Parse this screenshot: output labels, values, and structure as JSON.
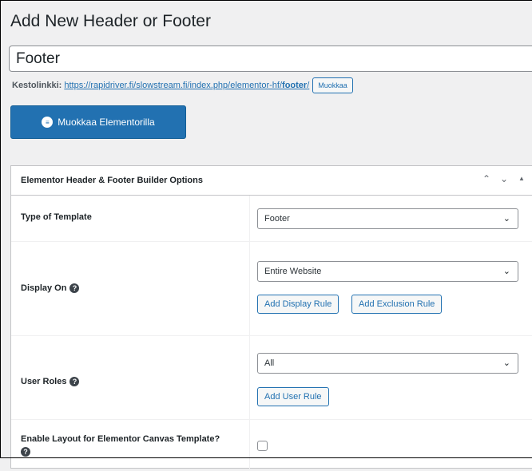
{
  "page": {
    "title": "Add New Header or Footer",
    "post_title_value": "Footer"
  },
  "permalink": {
    "label": "Kestolinkki:",
    "url_base": "https://rapidriver.fi/slowstream.fi/index.php/elementor-hf/",
    "url_slug": "footer",
    "url_trailing": "/",
    "edit_button": "Muokkaa"
  },
  "elementor_button": {
    "icon": "elementor-icon",
    "label": "Muokkaa Elementorilla"
  },
  "metabox": {
    "title": "Elementor Header & Footer Builder Options",
    "controls": [
      "chevron-up-icon",
      "chevron-down-icon",
      "triangle-up-icon"
    ]
  },
  "fields": {
    "template_type": {
      "label": "Type of Template",
      "value": "Footer"
    },
    "display_on": {
      "label": "Display On",
      "value": "Entire Website",
      "add_display_rule": "Add Display Rule",
      "add_exclusion_rule": "Add Exclusion Rule"
    },
    "user_roles": {
      "label": "User Roles",
      "value": "All",
      "add_user_rule": "Add User Rule"
    },
    "canvas_template": {
      "label": "Enable Layout for Elementor Canvas Template?",
      "checked": false
    }
  },
  "colors": {
    "primary": "#2271b1",
    "background": "#f0f0f1",
    "border": "#c3c4c7"
  }
}
